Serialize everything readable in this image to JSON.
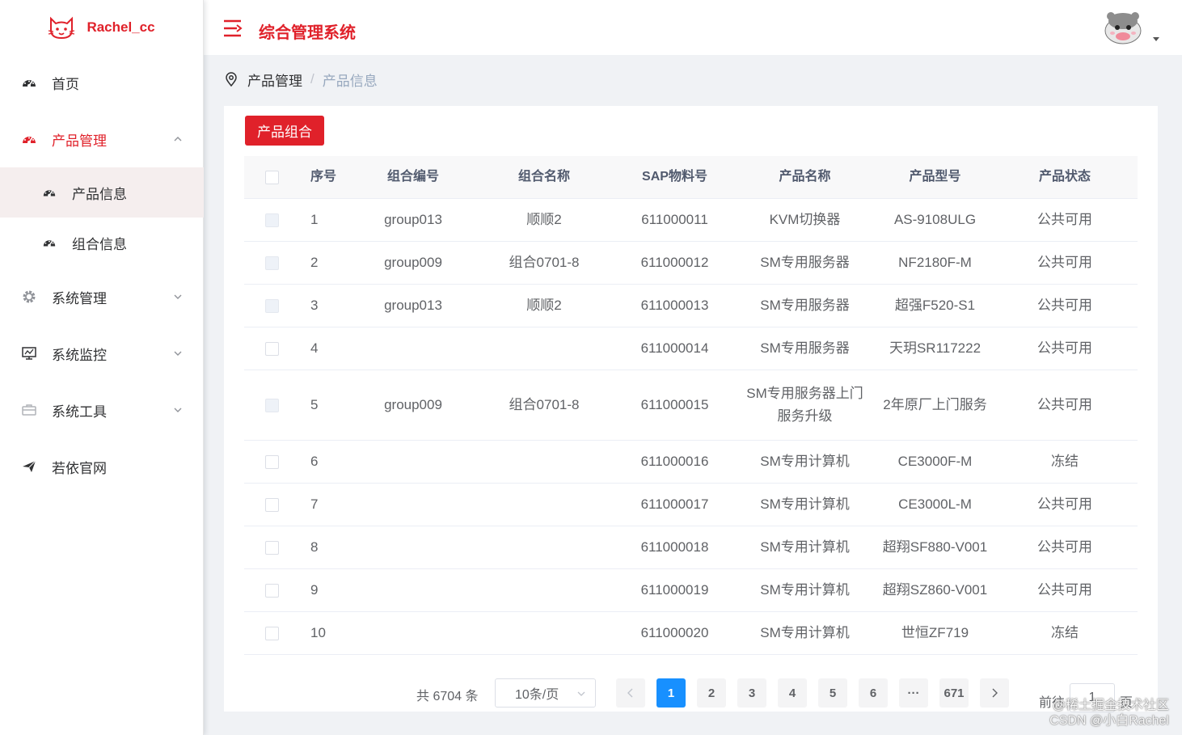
{
  "brand": {
    "name": "Rachel_cc",
    "color": "#e0212a"
  },
  "header": {
    "title": "综合管理系统",
    "menu_icon": "hamburger-icon",
    "avatar": "hamster-avatar"
  },
  "sidebar": {
    "items": [
      {
        "label": "首页",
        "icon": "dashboard-icon"
      },
      {
        "label": "产品管理",
        "icon": "dashboard-icon",
        "expanded": true,
        "children": [
          {
            "label": "产品信息",
            "icon": "dashboard-icon",
            "selected": true
          },
          {
            "label": "组合信息",
            "icon": "dashboard-icon"
          }
        ]
      },
      {
        "label": "系统管理",
        "icon": "gear-icon"
      },
      {
        "label": "系统监控",
        "icon": "monitor-icon"
      },
      {
        "label": "系统工具",
        "icon": "toolbox-icon"
      },
      {
        "label": "若依官网",
        "icon": "paper-plane-icon"
      }
    ]
  },
  "breadcrumb": {
    "items": [
      "产品管理",
      "产品信息"
    ],
    "separator": "/"
  },
  "toolbar": {
    "combo_label": "产品组合"
  },
  "table": {
    "columns": [
      "序号",
      "组合编号",
      "组合名称",
      "SAP物料号",
      "产品名称",
      "产品型号",
      "产品状态"
    ],
    "rows": [
      [
        "1",
        "group013",
        "顺顺2",
        "611000011",
        "KVM切换器",
        "AS-9108ULG",
        "公共可用"
      ],
      [
        "2",
        "group009",
        "组合0701-8",
        "611000012",
        "SM专用服务器",
        "NF2180F-M",
        "公共可用"
      ],
      [
        "3",
        "group013",
        "顺顺2",
        "611000013",
        "SM专用服务器",
        "超强F520-S1",
        "公共可用"
      ],
      [
        "4",
        "",
        "",
        "611000014",
        "SM专用服务器",
        "天玥SR117222",
        "公共可用"
      ],
      [
        "5",
        "group009",
        "组合0701-8",
        "611000015",
        "SM专用服务器上门服务升级",
        "2年原厂上门服务",
        "公共可用"
      ],
      [
        "6",
        "",
        "",
        "611000016",
        "SM专用计算机",
        "CE3000F-M",
        "冻结"
      ],
      [
        "7",
        "",
        "",
        "611000017",
        "SM专用计算机",
        "CE3000L-M",
        "公共可用"
      ],
      [
        "8",
        "",
        "",
        "611000018",
        "SM专用计算机",
        "超翔SF880-V001",
        "公共可用"
      ],
      [
        "9",
        "",
        "",
        "611000019",
        "SM专用计算机",
        "超翔SZ860-V001",
        "公共可用"
      ],
      [
        "10",
        "",
        "",
        "611000020",
        "SM专用计算机",
        "世恒ZF719",
        "冻结"
      ]
    ],
    "row_tinted_checkbox": [
      true,
      true,
      true,
      false,
      true,
      false,
      false,
      false,
      false,
      false
    ]
  },
  "pagination": {
    "total": "共 6704 条",
    "page_size": "10条/页",
    "pages": [
      "1",
      "2",
      "3",
      "4",
      "5",
      "6",
      "···",
      "671"
    ],
    "current": "1",
    "goto_label": "前往",
    "goto_value": "1",
    "goto_suffix": "页",
    "active_color": "#1890ff"
  },
  "watermark": {
    "line1": "@稀土掘金技术社区",
    "line2": "CSDN @小白Rachel"
  }
}
